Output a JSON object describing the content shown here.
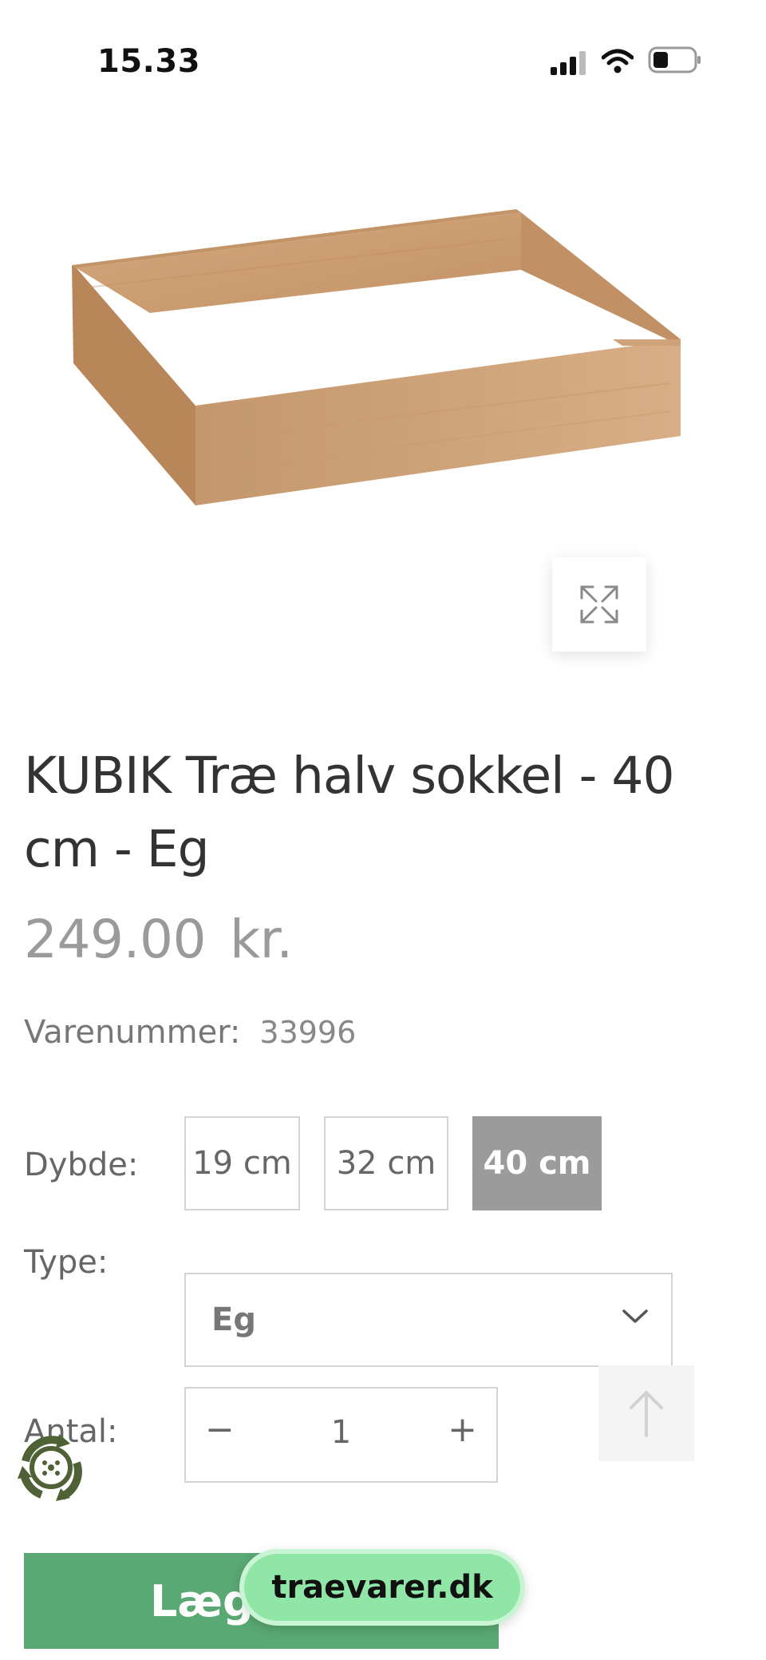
{
  "status": {
    "time": "15.33"
  },
  "product": {
    "title": "KUBIK Træ halv sokkel - 40 cm - Eg",
    "price": "249.00",
    "currency": "kr.",
    "sku_label": "Varenummer:",
    "sku": "33996"
  },
  "options": {
    "depth_label": "Dybde:",
    "depths": [
      "19 cm",
      "32 cm",
      "40 cm"
    ],
    "selected_depth": "40 cm",
    "type_label": "Type:",
    "type_value": "Eg",
    "quantity_label": "Antal:",
    "quantity": "1",
    "minus": "−",
    "plus": "+"
  },
  "cart": {
    "button_label": "Læg i kurv"
  },
  "site_badge": "traevarer.dk",
  "colors": {
    "accent_green": "#5aa873",
    "selected_gray": "#9b9b9b",
    "pill_green": "#8fe6a6"
  },
  "icons": [
    "signal-icon",
    "wifi-icon",
    "battery-icon",
    "expand-icon",
    "chevron-down-icon",
    "arrow-up-icon",
    "recycle-icon"
  ]
}
